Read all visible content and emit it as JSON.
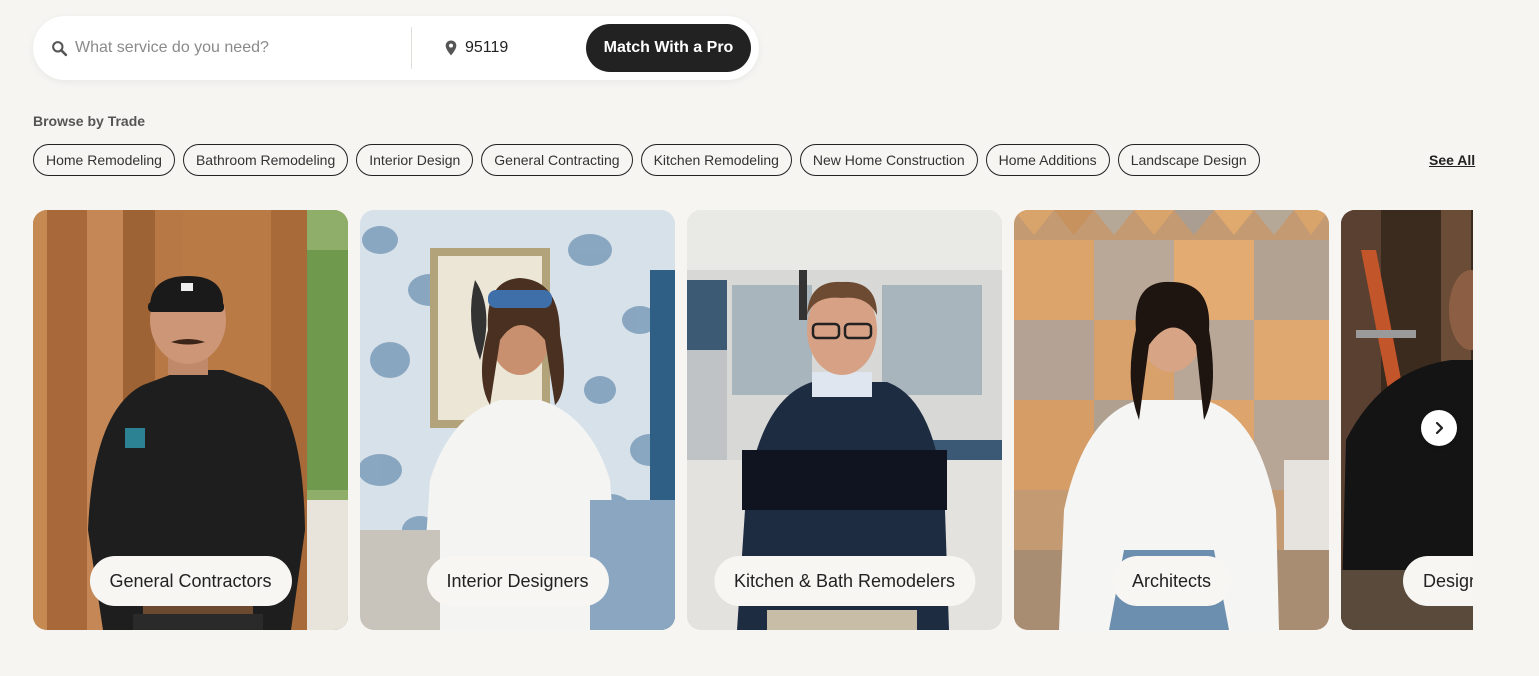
{
  "search": {
    "service_placeholder": "What service do you need?",
    "zip_value": "95119",
    "match_button_label": "Match With a Pro",
    "search_icon": "search-icon",
    "location_icon": "map-pin-icon"
  },
  "browse": {
    "heading": "Browse by Trade",
    "chips": [
      "Home Remodeling",
      "Bathroom Remodeling",
      "Interior Design",
      "General Contracting",
      "Kitchen Remodeling",
      "New Home Construction",
      "Home Additions",
      "Landscape Design"
    ],
    "see_all_label": "See All"
  },
  "cards": [
    {
      "label": "General Contractors"
    },
    {
      "label": "Interior Designers"
    },
    {
      "label": "Kitchen & Bath Remodelers"
    },
    {
      "label": "Architects"
    },
    {
      "label": "Designers"
    }
  ],
  "carousel": {
    "next_icon": "chevron-right-icon"
  },
  "colors": {
    "background": "#f6f5f2",
    "button": "#222222",
    "chip_border": "#222222"
  }
}
